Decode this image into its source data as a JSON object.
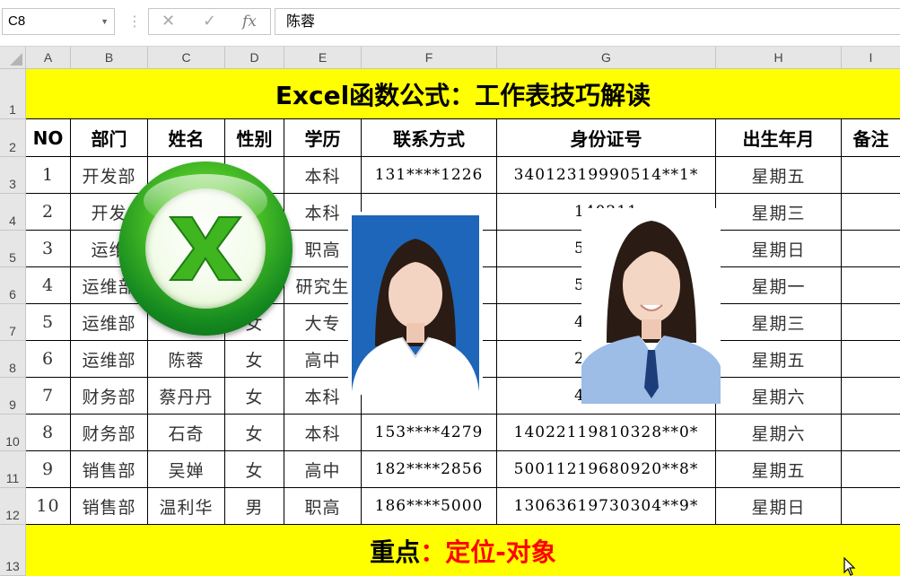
{
  "formula_bar": {
    "name_box": "C8",
    "cancel_icon": "✕",
    "enter_icon": "✓",
    "fx_label": "fx",
    "content": "陈蓉"
  },
  "columns": [
    "A",
    "B",
    "C",
    "D",
    "E",
    "F",
    "G",
    "H",
    "I"
  ],
  "rows": [
    "1",
    "2",
    "3",
    "4",
    "5",
    "6",
    "7",
    "8",
    "9",
    "10",
    "11",
    "12",
    "13"
  ],
  "sheet": {
    "title": "Excel函数公式：工作表技巧解读",
    "headers": [
      "NO",
      "部门",
      "姓名",
      "性别",
      "学历",
      "联系方式",
      "身份证号",
      "出生年月",
      "备注"
    ],
    "records": [
      [
        "1",
        "开发部",
        "",
        "",
        "本科",
        "131****1226",
        "34012319990514**1*",
        "星期五",
        ""
      ],
      [
        "2",
        "开发",
        "",
        "",
        "本科",
        "",
        "140211",
        "星期三",
        ""
      ],
      [
        "3",
        "运维",
        "",
        "",
        "职高",
        "",
        "542336",
        "星期日",
        ""
      ],
      [
        "4",
        "运维部",
        "",
        "",
        "研究生",
        "",
        "542129",
        "星期一",
        ""
      ],
      [
        "5",
        "运维部",
        "",
        "女",
        "大专",
        "",
        "411329",
        "星期三",
        ""
      ],
      [
        "6",
        "运维部",
        "陈蓉",
        "女",
        "高中",
        "",
        "230621",
        "星期五",
        ""
      ],
      [
        "7",
        "财务部",
        "蔡丹丹",
        "女",
        "本科",
        "",
        "450101",
        "星期六",
        ""
      ],
      [
        "8",
        "财务部",
        "石奇",
        "女",
        "本科",
        "153****4279",
        "14022119810328**0*",
        "星期六",
        ""
      ],
      [
        "9",
        "销售部",
        "吴婵",
        "女",
        "高中",
        "182****2856",
        "50011219680920**8*",
        "星期五",
        ""
      ],
      [
        "10",
        "销售部",
        "温利华",
        "男",
        "职高",
        "186****5000",
        "13063619730304**9*",
        "星期日",
        ""
      ]
    ],
    "footer_black": "重点",
    "footer_red": "：定位-对象"
  },
  "colors": {
    "title_fill": "#ffff00",
    "footer_red": "#ff0000",
    "header_fill": "#e6e6e6"
  }
}
